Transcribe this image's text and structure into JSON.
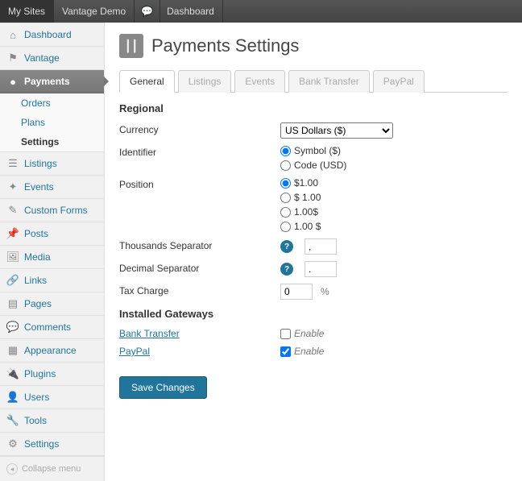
{
  "adminbar": {
    "mysites": "My Sites",
    "sitename": "Vantage Demo",
    "dashboard": "Dashboard"
  },
  "sidebar": {
    "items": [
      {
        "label": "Dashboard",
        "icon": "⌂"
      },
      {
        "label": "Vantage",
        "icon": "⚑"
      },
      {
        "label": "Payments",
        "icon": "💰",
        "active": true,
        "sub": [
          {
            "label": "Orders"
          },
          {
            "label": "Plans"
          },
          {
            "label": "Settings",
            "sel": true
          }
        ]
      },
      {
        "label": "Listings",
        "icon": "☰"
      },
      {
        "label": "Events",
        "icon": "✦"
      },
      {
        "label": "Custom Forms",
        "icon": "✎"
      },
      {
        "label": "Posts",
        "icon": "📌"
      },
      {
        "label": "Media",
        "icon": "🖼"
      },
      {
        "label": "Links",
        "icon": "🔗"
      },
      {
        "label": "Pages",
        "icon": "▤"
      },
      {
        "label": "Comments",
        "icon": "💬"
      },
      {
        "label": "Appearance",
        "icon": "▦"
      },
      {
        "label": "Plugins",
        "icon": "🔌"
      },
      {
        "label": "Users",
        "icon": "👤"
      },
      {
        "label": "Tools",
        "icon": "🔧"
      },
      {
        "label": "Settings",
        "icon": "⚙"
      }
    ],
    "collapse": "Collapse menu"
  },
  "page": {
    "title": "Payments Settings",
    "tabs": [
      "General",
      "Listings",
      "Events",
      "Bank Transfer",
      "PayPal"
    ]
  },
  "sections": {
    "regional": "Regional",
    "gateways": "Installed Gateways"
  },
  "form": {
    "currency_label": "Currency",
    "currency_value": "US Dollars ($)",
    "identifier_label": "Identifier",
    "identifier_options": [
      "Symbol ($)",
      "Code (USD)"
    ],
    "position_label": "Position",
    "position_options": [
      "$1.00",
      "$ 1.00",
      "1.00$",
      "1.00 $"
    ],
    "thousands_label": "Thousands Separator",
    "thousands_value": ",",
    "decimal_label": "Decimal Separator",
    "decimal_value": ".",
    "tax_label": "Tax Charge",
    "tax_value": "0",
    "pct": "%"
  },
  "gateways": {
    "bank": "Bank Transfer",
    "paypal": "PayPal",
    "enable": "Enable"
  },
  "buttons": {
    "save": "Save Changes"
  }
}
